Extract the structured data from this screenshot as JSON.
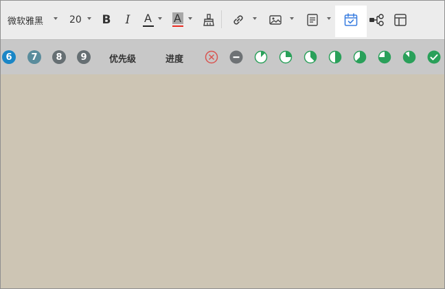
{
  "toolbar": {
    "font_name": "微软雅黑",
    "font_size": "20",
    "bold_label": "B",
    "italic_label": "I",
    "font_color_letter": "A",
    "highlight_letter": "A",
    "active_tool_icon": "calendar-check-icon",
    "colors": {
      "font_underline": "#222222",
      "highlight_underline": "#e8281e",
      "active_tool": "#3b7fe0"
    }
  },
  "markers": {
    "numbers": [
      {
        "label": "6",
        "color": "#1a86c6"
      },
      {
        "label": "7",
        "color": "#5a8c9c"
      },
      {
        "label": "8",
        "color": "#666f73"
      },
      {
        "label": "9",
        "color": "#666f73"
      }
    ],
    "priority_label": "优先级",
    "progress_label": "进度",
    "progress_levels": [
      0.125,
      0.25,
      0.375,
      0.5,
      0.625,
      0.75,
      0.875
    ],
    "progress_color": "#2aa05a",
    "cancel_color": "#d9534f",
    "pause_color": "#6e7275"
  }
}
